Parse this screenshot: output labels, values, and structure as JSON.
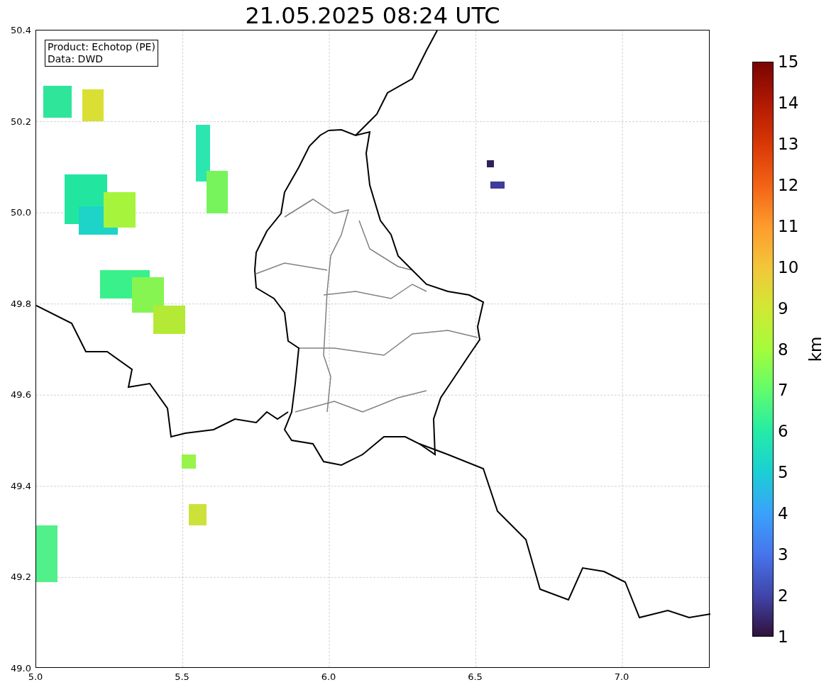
{
  "title": "21.05.2025 08:24 UTC",
  "legend": {
    "lines": [
      "Product: Echotop (PE)",
      "Data: DWD"
    ]
  },
  "plot": {
    "y_ticks": [
      "50.4",
      "50.2",
      "50.0",
      "49.8",
      "49.6",
      "49.4",
      "49.2",
      "49.0"
    ],
    "x_ticks": [
      "5.0",
      "5.5",
      "6.0",
      "6.5",
      "7.0"
    ]
  },
  "colorbar": {
    "ticks": [
      "15",
      "14",
      "13",
      "12",
      "11",
      "10",
      "9",
      "8",
      "7",
      "6",
      "5",
      "4",
      "3",
      "2",
      "1"
    ],
    "label": "km"
  }
}
